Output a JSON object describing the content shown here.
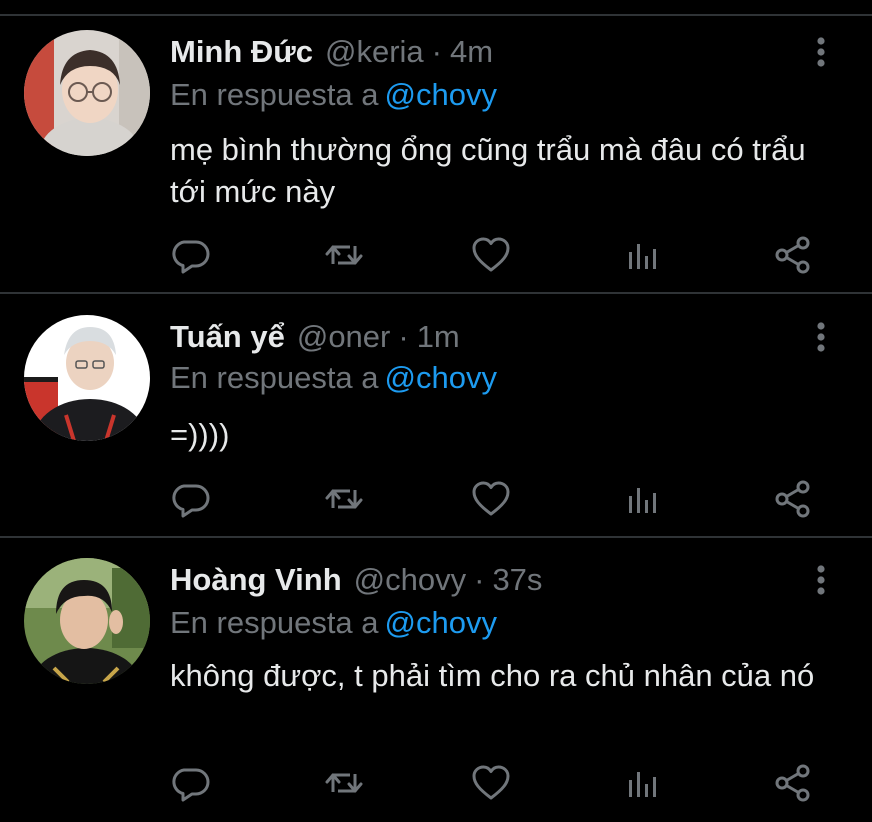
{
  "colors": {
    "background": "#000000",
    "primary_text": "#e7e9ea",
    "secondary_text": "#71767b",
    "link": "#1d9bf0",
    "divider": "#2f3336"
  },
  "icons": {
    "more": "more-vertical-icon",
    "reply": "reply-bubble-icon",
    "retweet": "retweet-icon",
    "like": "heart-icon",
    "analytics": "analytics-bars-icon",
    "share": "share-icon"
  },
  "tweets": [
    {
      "display_name": "Minh Đức",
      "handle": "@keria",
      "separator": "·",
      "time": "4m",
      "reply_prefix": "En respuesta a",
      "reply_to": "@chovy",
      "text": "mẹ bình thường ổng cũng trẩu mà đâu có trẩu tới mức này"
    },
    {
      "display_name": "Tuấn yể",
      "handle": "@oner",
      "separator": "·",
      "time": "1m",
      "reply_prefix": "En respuesta a",
      "reply_to": "@chovy",
      "text": "=))))"
    },
    {
      "display_name": "Hoàng Vinh",
      "handle": "@chovy",
      "separator": "·",
      "time": "37s",
      "reply_prefix": "En respuesta a",
      "reply_to": "@chovy",
      "text": "không được, t phải tìm cho ra chủ nhân của nó"
    }
  ]
}
